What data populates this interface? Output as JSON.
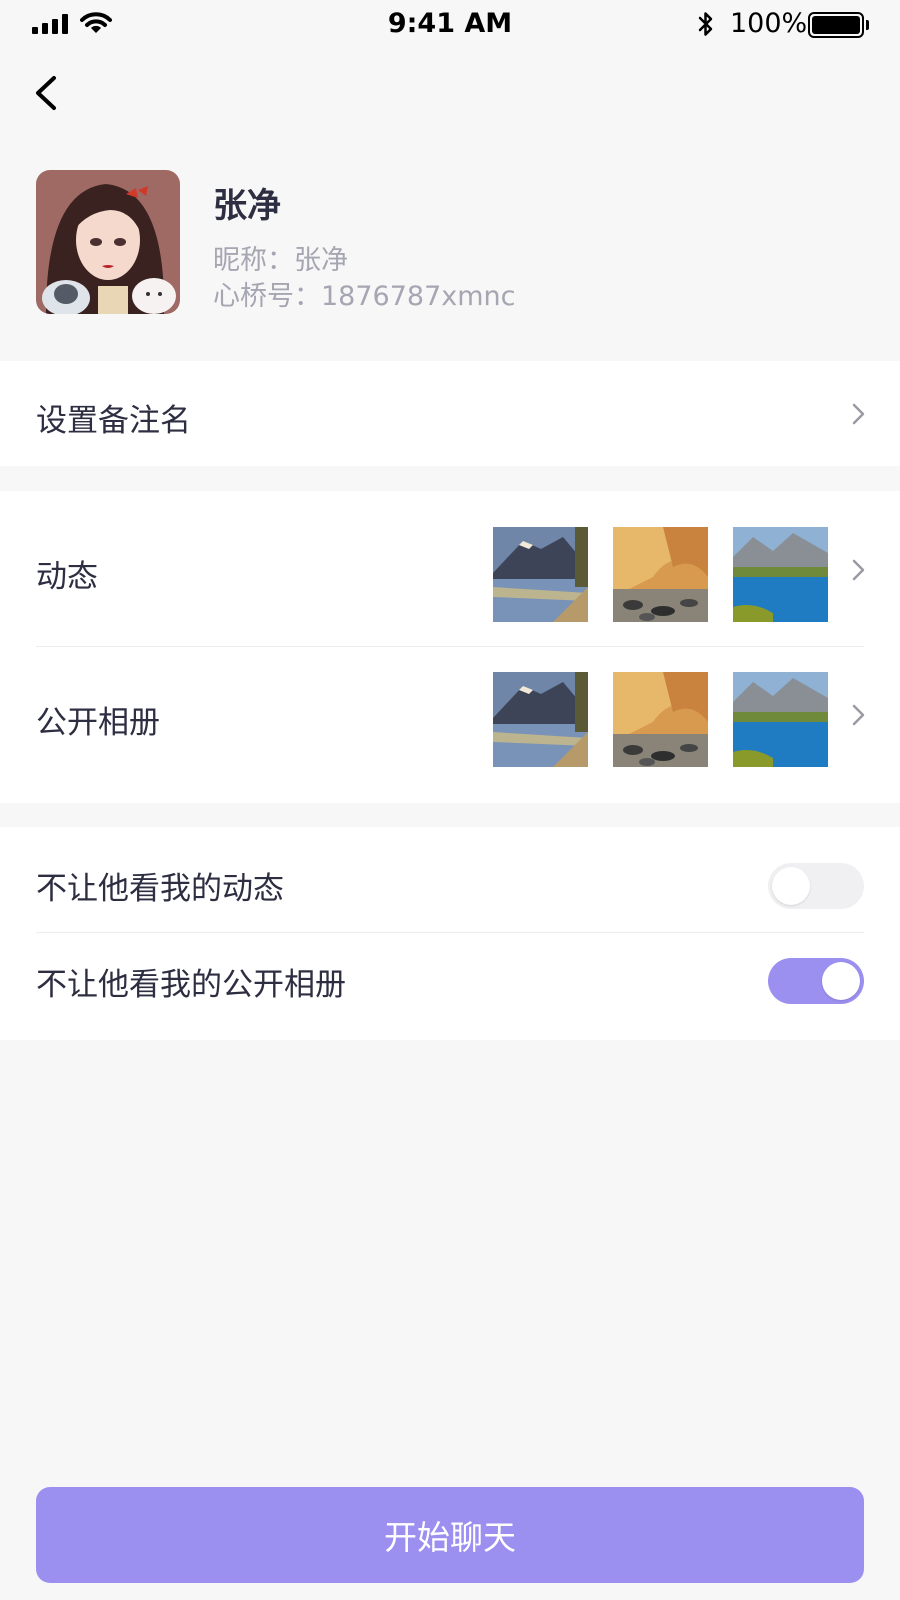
{
  "status_bar": {
    "time": "9:41 AM",
    "battery": "100%"
  },
  "profile": {
    "name": "张净",
    "nickname": "昵称：张净",
    "id_line": "心桥号：1876787xmnc"
  },
  "rows": {
    "remark": "设置备注名",
    "moments": "动态",
    "album": "公开相册",
    "hide_moments": "不让他看我的动态",
    "hide_album": "不让他看我的公开相册"
  },
  "toggles": {
    "hide_moments_on": false,
    "hide_album_on": true
  },
  "actions": {
    "start_chat": "开始聊天"
  },
  "colors": {
    "accent": "#9b8ff0",
    "text": "#2e2e42",
    "muted": "#a6a6b2",
    "background": "#f7f7f8"
  },
  "icons": [
    "signal-icon",
    "wifi-icon",
    "bluetooth-icon",
    "battery-icon",
    "back-icon",
    "chevron-right-icon"
  ]
}
